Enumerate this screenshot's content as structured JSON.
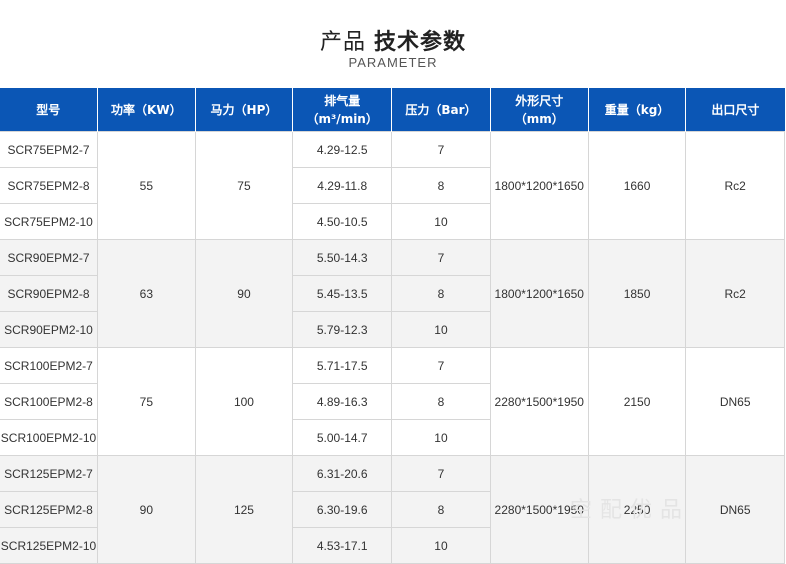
{
  "heading": {
    "light": "产品",
    "bold": "技术参数",
    "subtitle": "PARAMETER"
  },
  "columns": [
    {
      "line1": "型号",
      "line2": ""
    },
    {
      "line1": "功率（KW）",
      "line2": ""
    },
    {
      "line1": "马力（HP）",
      "line2": ""
    },
    {
      "line1": "排气量",
      "line2": "（m³/min）"
    },
    {
      "line1": "压力（Bar）",
      "line2": ""
    },
    {
      "line1": "外形尺寸",
      "line2": "（mm）"
    },
    {
      "line1": "重量（kg）",
      "line2": ""
    },
    {
      "line1": "出口尺寸",
      "line2": ""
    }
  ],
  "groups": [
    {
      "power": "55",
      "hp": "75",
      "dims": "1800*1200*1650",
      "weight": "1660",
      "outlet": "Rc2",
      "rows": [
        {
          "model": "SCR75EPM2-7",
          "flow": "4.29-12.5",
          "pressure": "7"
        },
        {
          "model": "SCR75EPM2-8",
          "flow": "4.29-11.8",
          "pressure": "8"
        },
        {
          "model": "SCR75EPM2-10",
          "flow": "4.50-10.5",
          "pressure": "10"
        }
      ]
    },
    {
      "power": "63",
      "hp": "90",
      "dims": "1800*1200*1650",
      "weight": "1850",
      "outlet": "Rc2",
      "rows": [
        {
          "model": "SCR90EPM2-7",
          "flow": "5.50-14.3",
          "pressure": "7"
        },
        {
          "model": "SCR90EPM2-8",
          "flow": "5.45-13.5",
          "pressure": "8"
        },
        {
          "model": "SCR90EPM2-10",
          "flow": "5.79-12.3",
          "pressure": "10"
        }
      ]
    },
    {
      "power": "75",
      "hp": "100",
      "dims": "2280*1500*1950",
      "weight": "2150",
      "outlet": "DN65",
      "rows": [
        {
          "model": "SCR100EPM2-7",
          "flow": "5.71-17.5",
          "pressure": "7"
        },
        {
          "model": "SCR100EPM2-8",
          "flow": "4.89-16.3",
          "pressure": "8"
        },
        {
          "model": "SCR100EPM2-10",
          "flow": "5.00-14.7",
          "pressure": "10"
        }
      ]
    },
    {
      "power": "90",
      "hp": "125",
      "dims": "2280*1500*1950",
      "weight": "2250",
      "outlet": "DN65",
      "rows": [
        {
          "model": "SCR125EPM2-7",
          "flow": "6.31-20.6",
          "pressure": "7"
        },
        {
          "model": "SCR125EPM2-8",
          "flow": "6.30-19.6",
          "pressure": "8"
        },
        {
          "model": "SCR125EPM2-10",
          "flow": "4.53-17.1",
          "pressure": "10"
        }
      ]
    }
  ],
  "watermark": "空配优品",
  "colors": {
    "header_bg": "#0b56b5",
    "header_text": "#ffffff",
    "alt_row_bg": "#f3f3f3",
    "border": "#d6d6d6"
  }
}
